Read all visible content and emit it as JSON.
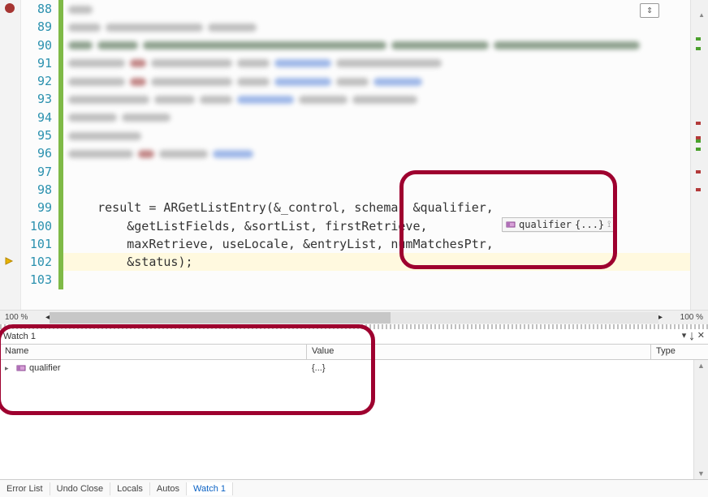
{
  "editor": {
    "first_line_no": 88,
    "last_line_no": 103,
    "breakpoint_line": 88,
    "exec_line": 102,
    "lines": {
      "99": "    result = ARGetListEntry(&_control, schema, &qualifier,",
      "100": "        &getListFields, &sortList, firstRetrieve,",
      "101": "        maxRetrieve, useLocale, &entryList, numMatchesPtr,",
      "102": "        &status);",
      "103": ""
    },
    "tooltip": {
      "label": "qualifier",
      "detail": "{...}"
    },
    "zoom_left": "100 %",
    "zoom_right": "100 %"
  },
  "watch": {
    "title": "Watch 1",
    "columns": {
      "name": "Name",
      "value": "Value",
      "type": "Type"
    },
    "rows": [
      {
        "name": "qualifier",
        "value": "{...}",
        "type": ""
      }
    ]
  },
  "tabs": {
    "items": [
      "Error List",
      "Undo Close",
      "Locals",
      "Autos",
      "Watch 1"
    ],
    "active": "Watch 1"
  },
  "icons": {
    "struct": "struct-icon",
    "pin": "pin-icon",
    "window_menu": "▾",
    "pin_glyph": "📌",
    "close": "✕",
    "expander": "▸",
    "scroll_up": "▲",
    "scroll_down": "▼",
    "outline": "⇕"
  }
}
